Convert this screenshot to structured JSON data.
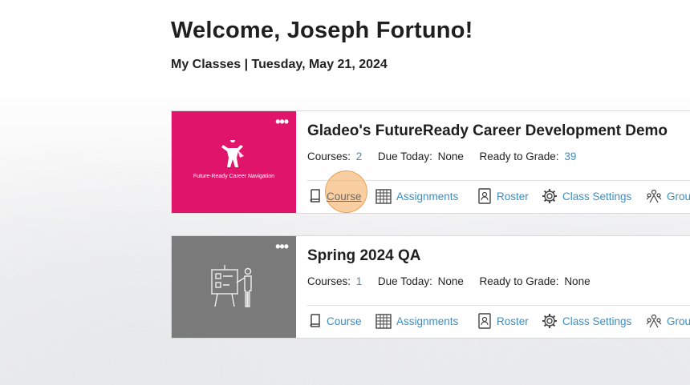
{
  "header": {
    "title": "Welcome, Joseph Fortuno!",
    "subtitle": "My Classes | Tuesday, May 21, 2024"
  },
  "classes": [
    {
      "name": "Gladeo's FutureReady Career Development Demo",
      "thumbnail_caption": "Future-Ready Career Navigation",
      "thumbnail_color": "#e0146a",
      "courses_label": "Courses:",
      "courses_value": "2",
      "due_label": "Due Today:",
      "due_value": "None",
      "grade_label": "Ready to Grade:",
      "grade_value": "39"
    },
    {
      "name": "Spring 2024 QA",
      "thumbnail_caption": "",
      "thumbnail_color": "#7a7a7a",
      "courses_label": "Courses:",
      "courses_value": "1",
      "due_label": "Due Today:",
      "due_value": "None",
      "grade_label": "Ready to Grade:",
      "grade_value": "None"
    }
  ],
  "actions": {
    "course": "Course",
    "assignments": "Assignments",
    "roster": "Roster",
    "settings": "Class Settings",
    "groups": "Groups"
  },
  "menu_dots": "•••",
  "colors": {
    "link": "#3b8ec4",
    "highlight": "#f4a754"
  },
  "icons": [
    "book-icon",
    "calendar-grid-icon",
    "roster-icon",
    "gear-icon",
    "groups-icon",
    "more-options-icon"
  ]
}
